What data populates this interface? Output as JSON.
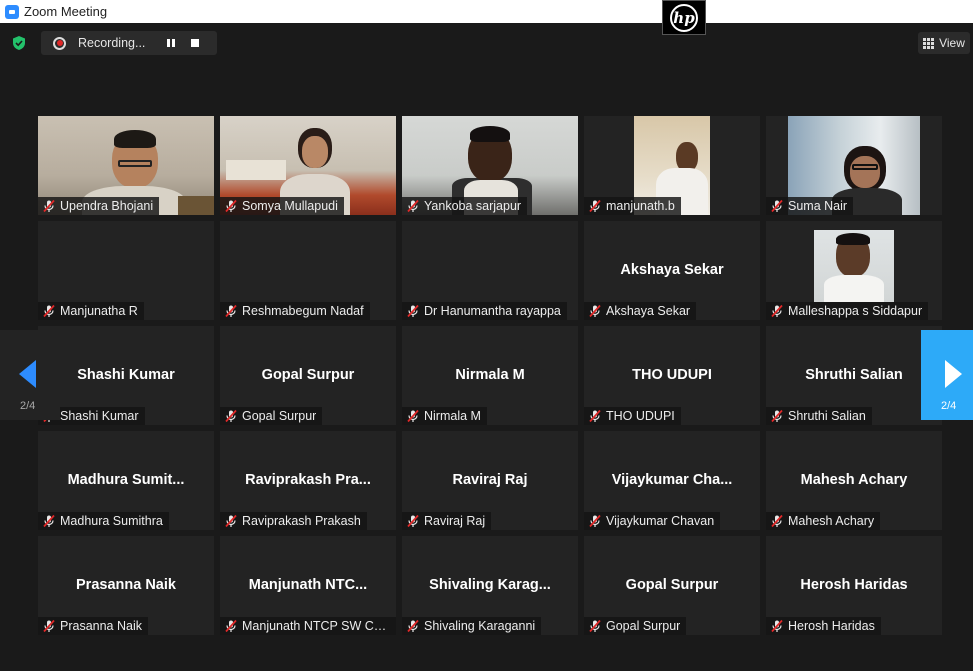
{
  "window": {
    "title": "Zoom Meeting"
  },
  "recording": {
    "label": "Recording..."
  },
  "view_button": {
    "label": "View"
  },
  "pagination": {
    "left_label": "2/4",
    "right_label": "2/4"
  },
  "colors": {
    "accent": "#2d8cff",
    "nav_active": "#2daaf8",
    "mic_muted": "#e02828",
    "shield": "#23c16b"
  },
  "participants": [
    {
      "name": "Upendra Bhojani",
      "display": "",
      "video": true,
      "scene": "man-indoor"
    },
    {
      "name": "Somya Mullapudi",
      "display": "",
      "video": true,
      "scene": "woman-banner"
    },
    {
      "name": "Yankoba sarjapur",
      "display": "",
      "video": true,
      "scene": "man-office"
    },
    {
      "name": "manjunath.b",
      "display": "",
      "video": true,
      "scene": "man-narrow"
    },
    {
      "name": "Suma Nair",
      "display": "",
      "video": true,
      "scene": "woman-glasses"
    },
    {
      "name": "Manjunatha R",
      "display": "",
      "video": false
    },
    {
      "name": "Reshmabegum Nadaf",
      "display": "",
      "video": false
    },
    {
      "name": "Dr Hanumantha rayappa",
      "display": "",
      "video": false
    },
    {
      "name": "Akshaya Sekar",
      "display": "Akshaya Sekar",
      "video": false
    },
    {
      "name": "Malleshappa s Siddapur",
      "display": "",
      "video": true,
      "scene": "man-small"
    },
    {
      "name": "Shashi Kumar",
      "display": "Shashi Kumar",
      "video": false
    },
    {
      "name": "Gopal Surpur",
      "display": "Gopal Surpur",
      "video": false
    },
    {
      "name": "Nirmala M",
      "display": "Nirmala M",
      "video": false
    },
    {
      "name": "THO UDUPI",
      "display": "THO UDUPI",
      "video": false
    },
    {
      "name": "Shruthi Salian",
      "display": "Shruthi Salian",
      "video": false
    },
    {
      "name": "Madhura Sumithra",
      "display": "Madhura  Sumit...",
      "video": false
    },
    {
      "name": "Raviprakash Prakash",
      "display": "Raviprakash  Pra...",
      "video": false
    },
    {
      "name": "Raviraj Raj",
      "display": "Raviraj Raj",
      "video": false
    },
    {
      "name": "Vijaykumar Chavan",
      "display": "Vijaykumar  Cha...",
      "video": false
    },
    {
      "name": "Mahesh Achary",
      "display": "Mahesh Achary",
      "video": false
    },
    {
      "name": "Prasanna Naik",
      "display": "Prasanna Naik",
      "video": false
    },
    {
      "name": "Manjunath NTCP SW Chi...",
      "display": "Manjunath  NTC...",
      "video": false
    },
    {
      "name": "Shivaling Karaganni",
      "display": "Shivaling  Karag...",
      "video": false
    },
    {
      "name": "Gopal Surpur",
      "display": "Gopal Surpur",
      "video": false
    },
    {
      "name": "Herosh Haridas",
      "display": "Herosh Haridas",
      "video": false
    }
  ]
}
